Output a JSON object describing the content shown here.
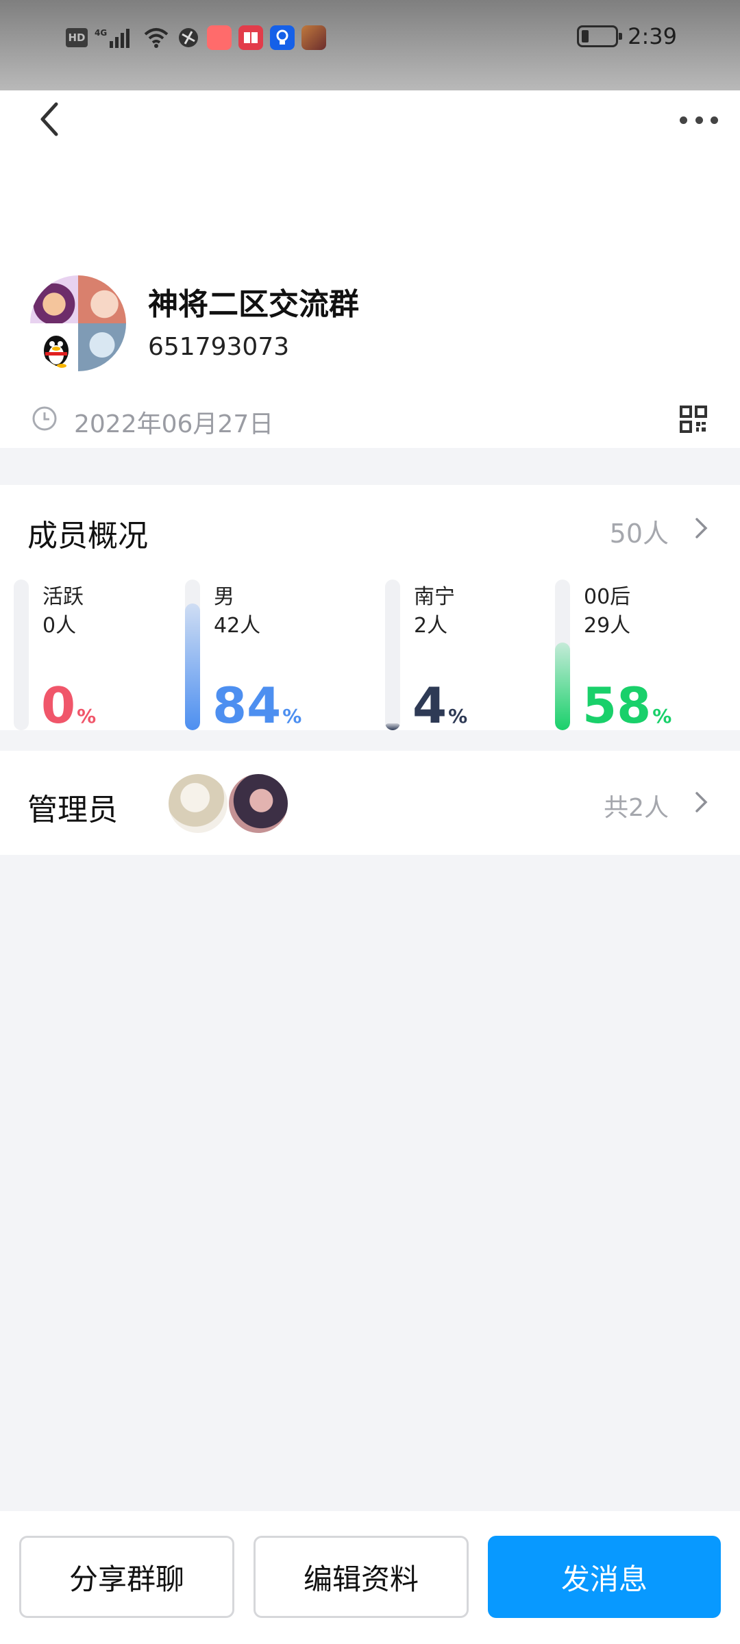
{
  "status_bar": {
    "time": "2:39",
    "network": "4G",
    "hd": "HD"
  },
  "group": {
    "name": "神将二区交流群",
    "id": "651793073",
    "created_date": "2022年06月27日"
  },
  "members": {
    "title": "成员概况",
    "total": "50人",
    "stats": [
      {
        "label": "活跃",
        "count": "0人",
        "percent": 0,
        "percent_text": "0",
        "color": "#f0566a"
      },
      {
        "label": "男",
        "count": "42人",
        "percent": 84,
        "percent_text": "84",
        "color": "#4d8ff0"
      },
      {
        "label": "南宁",
        "count": "2人",
        "percent": 4,
        "percent_text": "4",
        "color": "#2e3a55"
      },
      {
        "label": "00后",
        "count": "29人",
        "percent": 58,
        "percent_text": "58",
        "color": "#19d06a"
      }
    ],
    "percent_sign": "%"
  },
  "admins": {
    "title": "管理员",
    "total": "共2人"
  },
  "actions": {
    "share_label": "分享群聊",
    "edit_label": "编辑资料",
    "message_label": "发消息"
  }
}
